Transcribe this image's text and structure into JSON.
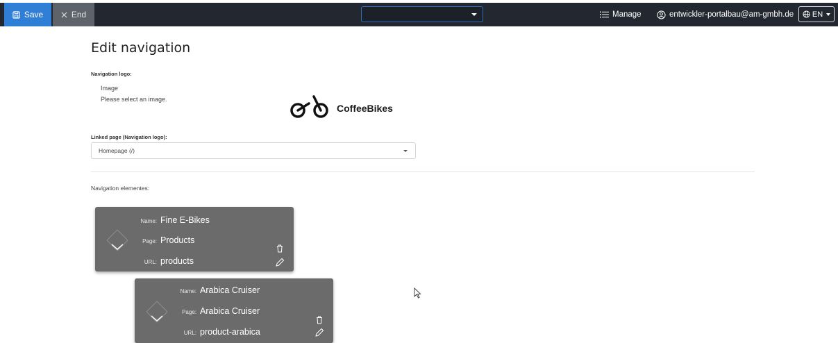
{
  "topbar": {
    "save_label": "Save",
    "end_label": "End",
    "manage_label": "Manage",
    "user_email": "entwickler-portalbau@am-gmbh.de",
    "language": "EN"
  },
  "page": {
    "title": "Edit navigation"
  },
  "logo_section": {
    "label": "Navigation logo:",
    "image_label": "Image",
    "image_hint": "Please select an image.",
    "logo_text": "CoffeeBikes"
  },
  "linked_page": {
    "label": "Linked page (Navigation logo):",
    "value": "Homepage (/)"
  },
  "nav_elements": {
    "label": "Navigation elementes:",
    "items": [
      {
        "name_key": "Name:",
        "name": "Fine E-Bikes",
        "page_key": "Page:",
        "page": "Products",
        "url_key": "URL:",
        "url": "products"
      },
      {
        "name_key": "Name:",
        "name": "Arabica Cruiser",
        "page_key": "Page:",
        "page": "Arabica Cruiser",
        "url_key": "URL:",
        "url": "product-arabica"
      }
    ]
  },
  "colors": {
    "topbar": "#23272f",
    "save_button": "#2f7fd6",
    "end_button": "#5d626b",
    "card": "#6b6b6b"
  },
  "icons": [
    "save-icon",
    "close-icon",
    "chevron-down-icon",
    "list-icon",
    "user-icon",
    "globe-icon",
    "bicycle-logo-icon",
    "drag-handle-icon",
    "trash-icon",
    "pencil-icon",
    "mouse-cursor-icon"
  ]
}
